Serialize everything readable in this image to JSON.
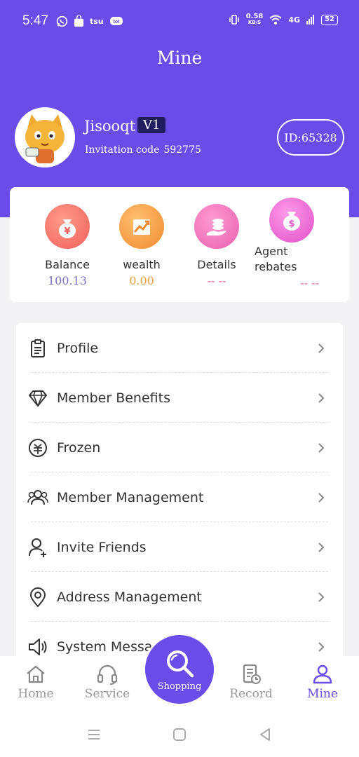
{
  "status_bar": {
    "time": "5:47",
    "app_icons": [
      "whatsapp-icon",
      "shopping-bag-icon",
      "tsu-icon",
      "chat-icon"
    ],
    "speed_value": "0.58",
    "speed_unit": "KB/S",
    "network": "4G",
    "battery": "52"
  },
  "header": {
    "title": "Mine"
  },
  "profile": {
    "username": "Jisooqt",
    "level": "V1",
    "invite_label": "Invitation code",
    "invite_code": "592775",
    "id_text": "ID:65328"
  },
  "stats": [
    {
      "icon": "money-bag-yen-icon",
      "label": "Balance",
      "value": "100.13",
      "value_color": "#7a6fc2"
    },
    {
      "icon": "trend-chart-icon",
      "label": "wealth",
      "value": "0.00",
      "value_color": "#e8a040"
    },
    {
      "icon": "coins-hand-icon",
      "label": "Details",
      "value": "-- --",
      "value_color": "#e8609a"
    },
    {
      "icon": "money-bag-dollar-icon",
      "label": "Agent rebates",
      "value": "-- --",
      "value_color": "#e8609a"
    }
  ],
  "menu": [
    {
      "icon": "clipboard-icon",
      "label": "Profile"
    },
    {
      "icon": "diamond-icon",
      "label": "Member Benefits"
    },
    {
      "icon": "frozen-coin-icon",
      "label": "Frozen"
    },
    {
      "icon": "users-icon",
      "label": "Member Management"
    },
    {
      "icon": "add-user-icon",
      "label": "Invite Friends"
    },
    {
      "icon": "location-pin-icon",
      "label": "Address Management"
    },
    {
      "icon": "speaker-icon",
      "label": "System Messa"
    }
  ],
  "bottom_nav": {
    "home": "Home",
    "service": "Service",
    "shopping": "Shopping",
    "record": "Record",
    "mine": "Mine"
  },
  "colors": {
    "accent": "#6a4ce8",
    "badge": "#1f1d5e"
  }
}
